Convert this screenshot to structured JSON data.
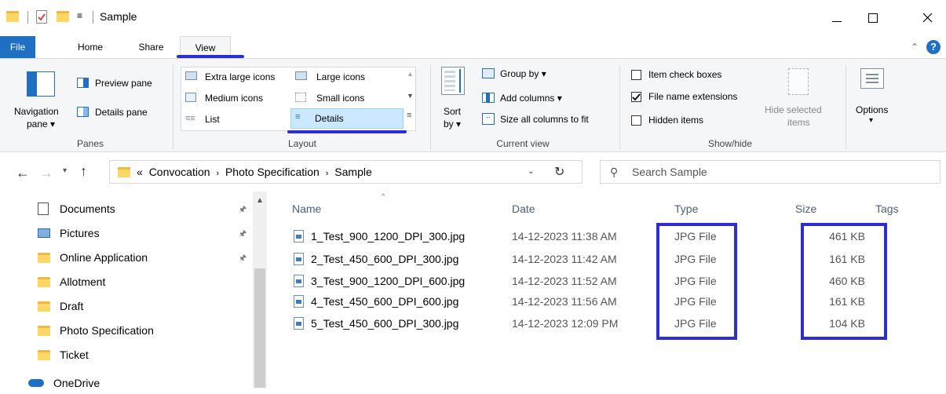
{
  "window": {
    "title": "Sample"
  },
  "tabs": [
    {
      "label": "File"
    },
    {
      "label": "Home"
    },
    {
      "label": "Share"
    },
    {
      "label": "View"
    }
  ],
  "ribbon": {
    "panes": {
      "navigation_pane": "Navigation",
      "navigation_pane_sub": "pane",
      "preview_pane": "Preview pane",
      "details_pane": "Details pane",
      "group_label": "Panes"
    },
    "layout": {
      "extra_large": "Extra large icons",
      "large": "Large icons",
      "medium": "Medium icons",
      "small": "Small icons",
      "list": "List",
      "details": "Details",
      "group_label": "Layout"
    },
    "current_view": {
      "sort": "Sort",
      "sort_sub": "by",
      "group_by": "Group by",
      "add_columns": "Add columns",
      "size_all": "Size all columns to fit",
      "group_label": "Current view"
    },
    "show_hide": {
      "item_check_boxes": "Item check boxes",
      "item_check_boxes_checked": false,
      "file_name_extensions": "File name extensions",
      "file_name_extensions_checked": true,
      "hidden_items": "Hidden items",
      "hidden_items_checked": false,
      "hide_selected": "Hide selected",
      "hide_selected_sub": "items",
      "group_label": "Show/hide"
    },
    "options": "Options"
  },
  "address": {
    "overflow": "«",
    "crumbs": [
      "Convocation",
      "Photo Specification",
      "Sample"
    ],
    "search_placeholder": "Search Sample"
  },
  "nav": {
    "items": [
      {
        "label": "Documents",
        "icon": "documents-icon",
        "pinned": true
      },
      {
        "label": "Pictures",
        "icon": "pictures-icon",
        "pinned": true
      },
      {
        "label": "Online Application",
        "icon": "folder-icon",
        "pinned": true
      },
      {
        "label": "Allotment",
        "icon": "folder-icon",
        "pinned": false
      },
      {
        "label": "Draft",
        "icon": "folder-icon",
        "pinned": false
      },
      {
        "label": "Photo Specification",
        "icon": "folder-icon",
        "pinned": false
      },
      {
        "label": "Ticket",
        "icon": "folder-icon",
        "pinned": false
      },
      {
        "label": "OneDrive",
        "icon": "onedrive-icon",
        "pinned": false
      }
    ]
  },
  "columns": {
    "name": "Name",
    "date": "Date",
    "type": "Type",
    "size": "Size",
    "tags": "Tags"
  },
  "files": [
    {
      "name": "1_Test_900_1200_DPI_300.jpg",
      "date": "14-12-2023 11:38 AM",
      "type": "JPG File",
      "size": "461 KB"
    },
    {
      "name": "2_Test_450_600_DPI_300.jpg",
      "date": "14-12-2023 11:42 AM",
      "type": "JPG File",
      "size": "161 KB"
    },
    {
      "name": "3_Test_900_1200_DPI_600.jpg",
      "date": "14-12-2023 11:52 AM",
      "type": "JPG File",
      "size": "460 KB"
    },
    {
      "name": "4_Test_450_600_DPI_600.jpg",
      "date": "14-12-2023 11:56 AM",
      "type": "JPG File",
      "size": "161 KB"
    },
    {
      "name": "5_Test_450_600_DPI_300.jpg",
      "date": "14-12-2023 12:09 PM",
      "type": "JPG File",
      "size": "104 KB"
    }
  ],
  "colors": {
    "accent": "#0067c0",
    "annotation": "#2b2fcf",
    "selected": "#cce8ff",
    "folder": "#ffd767"
  }
}
